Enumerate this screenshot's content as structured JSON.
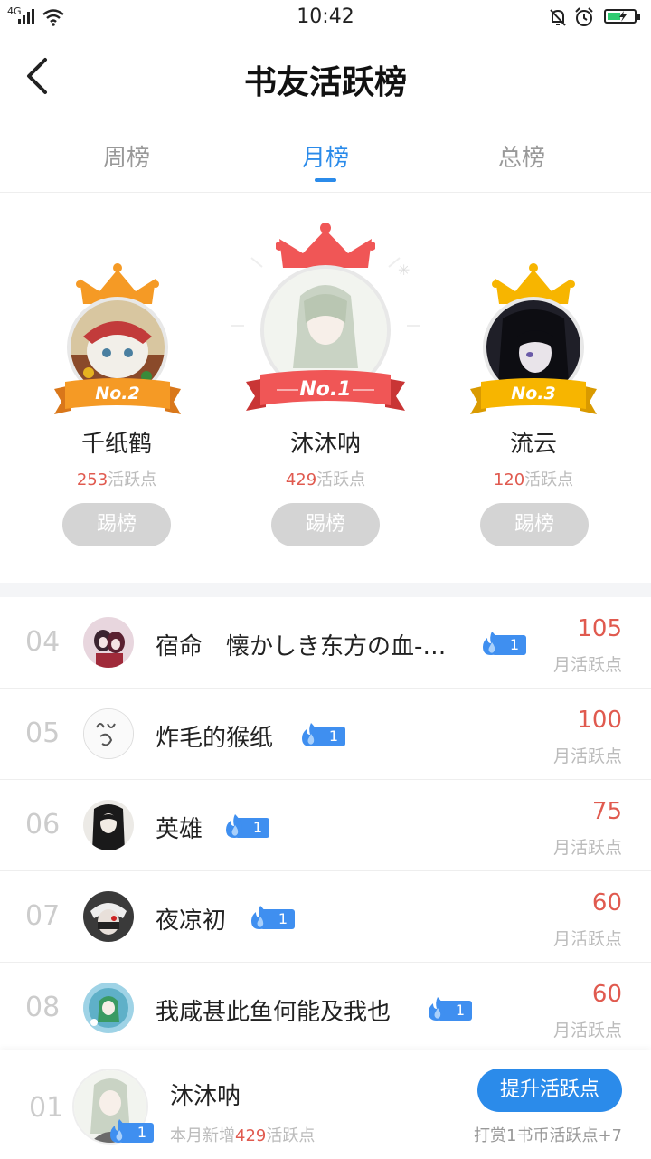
{
  "status_bar": {
    "network": "4G",
    "time": "10:42"
  },
  "header": {
    "title": "书友活跃榜"
  },
  "tabs": [
    {
      "label": "周榜",
      "active": false
    },
    {
      "label": "月榜",
      "active": true
    },
    {
      "label": "总榜",
      "active": false
    }
  ],
  "podium": {
    "first": {
      "rank_label": "No.1",
      "name": "沐沐呐",
      "points": "429",
      "unit": "活跃点",
      "kick_label": "踢榜",
      "crown_color": "#f05656"
    },
    "second": {
      "rank_label": "No.2",
      "name": "千纸鹤",
      "points": "253",
      "unit": "活跃点",
      "kick_label": "踢榜",
      "crown_color": "#f59a25"
    },
    "third": {
      "rank_label": "No.3",
      "name": "流云",
      "points": "120",
      "unit": "活跃点",
      "kick_label": "踢榜",
      "crown_color": "#f7b500"
    }
  },
  "list": [
    {
      "rank": "04",
      "name": "宿命　懐かしき东方の血-…",
      "level": "1",
      "value": "105",
      "unit": "月活跃点"
    },
    {
      "rank": "05",
      "name": "炸毛的猴纸",
      "level": "1",
      "value": "100",
      "unit": "月活跃点"
    },
    {
      "rank": "06",
      "name": "英雄",
      "level": "1",
      "value": "75",
      "unit": "月活跃点"
    },
    {
      "rank": "07",
      "name": "夜凉初",
      "level": "1",
      "value": "60",
      "unit": "月活跃点"
    },
    {
      "rank": "08",
      "name": "我咸甚此鱼何能及我也",
      "level": "1",
      "value": "60",
      "unit": "月活跃点"
    }
  ],
  "me": {
    "rank": "01",
    "name": "沐沐呐",
    "level": "1",
    "sub_prefix": "本月新增",
    "sub_value": "429",
    "sub_suffix": "活跃点",
    "button_label": "提升活跃点",
    "hint": "打赏1书币活跃点+7"
  },
  "colors": {
    "accent": "#2b8bea",
    "points_red": "#e05a4f",
    "badge_blue": "#3f8ff0"
  }
}
